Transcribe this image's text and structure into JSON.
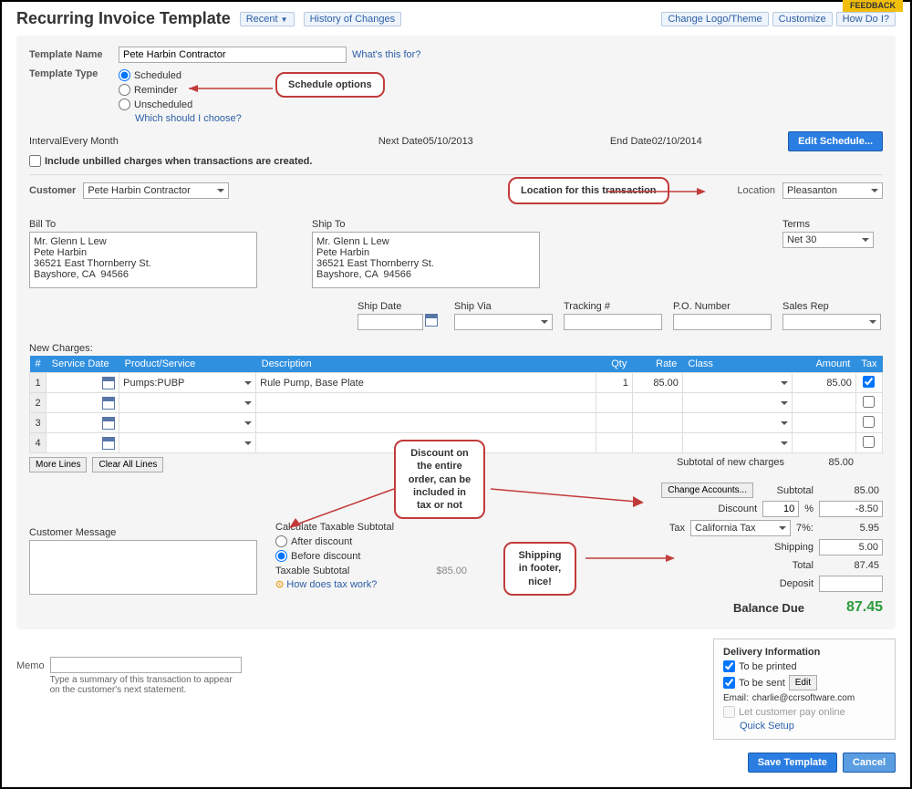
{
  "header": {
    "title": "Recurring Invoice Template",
    "recent": "Recent",
    "history": "History of Changes",
    "change_theme": "Change Logo/Theme",
    "customize": "Customize",
    "how_do_i": "How Do I?",
    "feedback": "FEEDBACK"
  },
  "template": {
    "name_label": "Template Name",
    "name_value": "Pete Harbin Contractor",
    "whats_this": "What's this for?",
    "type_label": "Template Type",
    "scheduled": "Scheduled",
    "reminder": "Reminder",
    "unscheduled": "Unscheduled",
    "which_choose": "Which should I choose?"
  },
  "schedule": {
    "interval_label": "Interval",
    "interval_value": "Every Month",
    "next_label": "Next Date",
    "next_value": "05/10/2013",
    "end_label": "End Date",
    "end_value": "02/10/2014",
    "include_unbilled": "Include unbilled charges when transactions are created.",
    "edit_btn": "Edit Schedule..."
  },
  "customer": {
    "label": "Customer",
    "value": "Pete Harbin Contractor",
    "location_label": "Location",
    "location_value": "Pleasanton"
  },
  "billto": {
    "label": "Bill To",
    "text": "Mr. Glenn L Lew\nPete Harbin\n36521 East Thornberry St.\nBayshore, CA  94566"
  },
  "shipto": {
    "label": "Ship To",
    "text": "Mr. Glenn L Lew\nPete Harbin\n36521 East Thornberry St.\nBayshore, CA  94566"
  },
  "terms": {
    "label": "Terms",
    "value": "Net 30"
  },
  "dates": {
    "ship_date": "Ship Date",
    "ship_via": "Ship Via",
    "tracking": "Tracking #",
    "po": "P.O. Number",
    "salesrep": "Sales Rep"
  },
  "charges": {
    "header": "New Charges:",
    "cols": {
      "num": "#",
      "service_date": "Service Date",
      "product": "Product/Service",
      "desc": "Description",
      "qty": "Qty",
      "rate": "Rate",
      "class": "Class",
      "amount": "Amount",
      "tax": "Tax"
    },
    "rows": [
      {
        "num": "1",
        "product": "Pumps:PUBP",
        "desc": "Rule Pump, Base Plate",
        "qty": "1",
        "rate": "85.00",
        "amount": "85.00",
        "tax_checked": true
      },
      {
        "num": "2"
      },
      {
        "num": "3"
      },
      {
        "num": "4"
      }
    ],
    "more_lines": "More Lines",
    "clear_all": "Clear All Lines"
  },
  "totals": {
    "subtotal_charges_label": "Subtotal of new charges",
    "subtotal_charges": "85.00",
    "change_accounts": "Change Accounts...",
    "subtotal_label": "Subtotal",
    "subtotal": "85.00",
    "discount_label": "Discount",
    "discount_pct": "10",
    "pct_sign": "%",
    "discount_amt": "-8.50",
    "tax_label": "Tax",
    "tax_name": "California Tax",
    "tax_pct": "7%:",
    "tax_amt": "5.95",
    "shipping_label": "Shipping",
    "shipping_amt": "5.00",
    "total_label": "Total",
    "total": "87.45",
    "deposit_label": "Deposit",
    "deposit": "",
    "balance_label": "Balance Due",
    "balance": "87.45"
  },
  "taxcalc": {
    "header": "Calculate Taxable Subtotal",
    "after": "After discount",
    "before": "Before discount",
    "taxable_sub_label": "Taxable Subtotal",
    "taxable_sub": "$85.00",
    "how_tax": "How does tax work?"
  },
  "custmsg": {
    "label": "Customer Message"
  },
  "memo": {
    "label": "Memo",
    "hint": "Type a summary of this transaction to appear on the customer's next statement."
  },
  "delivery": {
    "header": "Delivery Information",
    "printed": "To be printed",
    "sent": "To be sent",
    "edit": "Edit",
    "email_label": "Email:",
    "email": "charlie@ccrsoftware.com",
    "let_pay": "Let customer pay online",
    "quick_setup": "Quick Setup"
  },
  "footer": {
    "save": "Save Template",
    "cancel": "Cancel"
  },
  "annot": {
    "schedule_opts": "Schedule options",
    "location": "Location for this transaction",
    "discount": "Discount on the entire order, can be included in tax or not",
    "shipping": "Shipping in footer, nice!"
  }
}
